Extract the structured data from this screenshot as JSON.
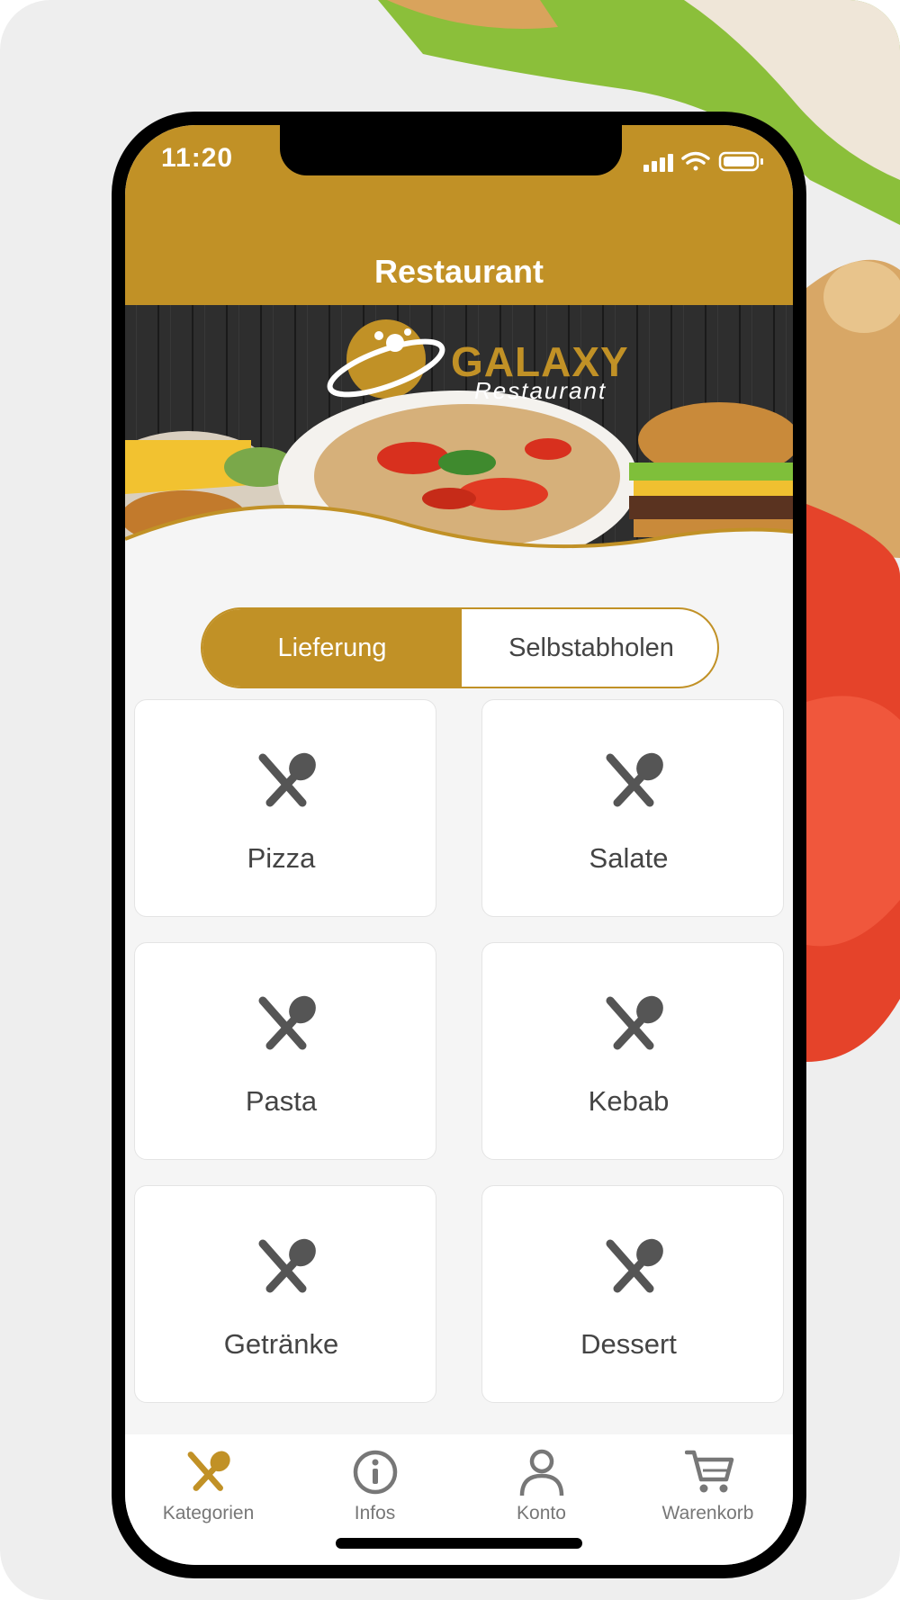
{
  "status_bar": {
    "time": "11:20"
  },
  "header": {
    "title": "Restaurant"
  },
  "banner": {
    "brand_name": "GALAXY",
    "brand_sub": "Restaurant"
  },
  "order_mode": {
    "options": [
      "Lieferung",
      "Selbstabholen"
    ],
    "selected": "Lieferung"
  },
  "categories": [
    {
      "label": "Pizza",
      "icon": "cutlery-icon"
    },
    {
      "label": "Salate",
      "icon": "cutlery-icon"
    },
    {
      "label": "Pasta",
      "icon": "cutlery-icon"
    },
    {
      "label": "Kebab",
      "icon": "cutlery-icon"
    },
    {
      "label": "Getränke",
      "icon": "cutlery-icon"
    },
    {
      "label": "Dessert",
      "icon": "cutlery-icon"
    }
  ],
  "tabbar": {
    "items": [
      {
        "label": "Kategorien",
        "icon": "cutlery-icon",
        "active": true
      },
      {
        "label": "Infos",
        "icon": "info-icon",
        "active": false
      },
      {
        "label": "Konto",
        "icon": "user-icon",
        "active": false
      },
      {
        "label": "Warenkorb",
        "icon": "cart-icon",
        "active": false
      }
    ]
  },
  "colors": {
    "brand": "#c19126",
    "icon_gray": "#555555",
    "text_gray": "#444444"
  }
}
